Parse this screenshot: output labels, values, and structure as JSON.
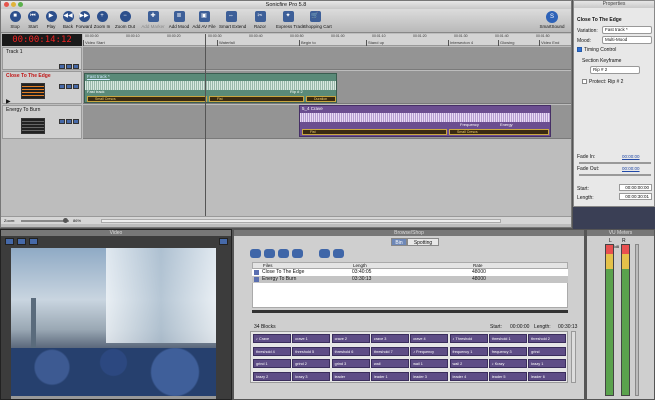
{
  "app": {
    "title": "Sonicfire Pro 5.8"
  },
  "toolbar": {
    "buttons": [
      {
        "label": "Stop",
        "icon": "stop-icon",
        "glyph": "■"
      },
      {
        "label": "Start",
        "icon": "start-icon",
        "glyph": "⏮"
      },
      {
        "label": "Play",
        "icon": "play-icon",
        "glyph": "▶"
      },
      {
        "label": "Back",
        "icon": "back-icon",
        "glyph": "◀◀"
      },
      {
        "label": "Forward",
        "icon": "forward-icon",
        "glyph": "▶▶"
      },
      {
        "label": "Zoom In",
        "icon": "zoom-in-icon",
        "glyph": "+"
      },
      {
        "label": "Zoom Out",
        "icon": "zoom-out-icon",
        "glyph": "−"
      },
      {
        "label": "Add Marker",
        "icon": "add-marker-icon",
        "glyph": "✚"
      },
      {
        "label": "Add Mood",
        "icon": "add-mood-icon",
        "glyph": "≣"
      },
      {
        "label": "Add AV File",
        "icon": "add-av-file-icon",
        "glyph": "▣"
      },
      {
        "label": "Smart Extend",
        "icon": "smart-extend-icon",
        "glyph": "⇔"
      },
      {
        "label": "Razor",
        "icon": "razor-icon",
        "glyph": "✂"
      },
      {
        "label": "Express Track",
        "icon": "express-track-icon",
        "glyph": "✦"
      },
      {
        "label": "Shopping Cart",
        "icon": "shopping-cart-icon",
        "glyph": "🛒"
      }
    ],
    "smartsound_label": "SmartSound"
  },
  "timeline": {
    "timecode": "00:00:14:12",
    "ruler_times": [
      "00:00:00",
      "00:00:10",
      "00:00:20",
      "00:00:30",
      "00:00:40",
      "00:00:50",
      "00:01:00",
      "00:01:10",
      "00:01:20",
      "00:01:30",
      "00:01:40",
      "00:01:50"
    ],
    "markers": [
      "Video Start",
      "Waterfall",
      "Begin to",
      "Stand up",
      "Intersecton 4",
      "Glowing",
      "Video End"
    ],
    "track1_label": "Track 1",
    "track2_label": "Close To The Edge",
    "track3_label": "Energy To Burn",
    "clip1": {
      "name": "Fast track *",
      "sub1": "Fast track",
      "sub2": "Rip # 2",
      "seg1": "Small Crescs",
      "seg2": "Fist",
      "seg3": "Duration"
    },
    "clip2": {
      "name": "5_4 Crave",
      "sub1": "Frequency",
      "sub2": "Energy",
      "seg1": "Fist",
      "seg2": "Small Crescs"
    },
    "zoom_label": "Zoom:",
    "zoom_value": "86%"
  },
  "properties": {
    "title": "Properties",
    "track_name": "Close To The Edge",
    "variation_label": "Variation:",
    "variation_value": "Fast track *",
    "mood_label": "Mood:",
    "mood_value": "Multi-Mood",
    "timing_control": "Timing Control",
    "section_keyframe": "Section Keyframe",
    "keyframe_value": "Rip # 2",
    "protect_label": "Protect: Rip # 2",
    "fade_in_label": "Fade In:",
    "fade_in_value": "00:00:00",
    "fade_out_label": "Fade Out:",
    "fade_out_value": "00:00:00",
    "start_label": "Start:",
    "start_value": "00:00:00:00",
    "length_label": "Length:",
    "length_value": "00:00:30:01"
  },
  "video": {
    "title": "Video"
  },
  "browser": {
    "title": "Browse/Shop",
    "tab_bin": "Bin",
    "tab_spotting": "Spotting",
    "col_files": "Files",
    "col_length": "Length",
    "col_rate": "Rate",
    "rows": [
      {
        "name": "Close To The Edge",
        "length": "03:40:05",
        "rate": "48000"
      },
      {
        "name": "Energy To Burn",
        "length": "03:30:13",
        "rate": "48000"
      }
    ],
    "blocks_count": "34 Blocks",
    "start_label": "Start:",
    "start_value": "00:00:00",
    "length_label": "Length:",
    "length_value": "00:30:13",
    "blocks": [
      "♪ Crave",
      "crave 1",
      "crave 2",
      "crave 3",
      "crave 4",
      "♪ Threshold",
      "threshold 1",
      "threshold 2",
      "threshold 4",
      "threshold 5",
      "threshold 6",
      "threshold 7",
      "♪ Frequency",
      "frequency 1",
      "frequency 3",
      "grind",
      "grind 1",
      "grind 2",
      "grind 3",
      "wail",
      "wail 1",
      "wail 2",
      "♪ Krazy",
      "krazy 1",
      "krazy 2",
      "krazy 3",
      "leader",
      "leader 1",
      "leader 3",
      "leader 4",
      "leader 5",
      "leader 6"
    ]
  },
  "vu": {
    "title": "VU Meters",
    "left": "L",
    "right": "R",
    "scale": "0dB"
  }
}
